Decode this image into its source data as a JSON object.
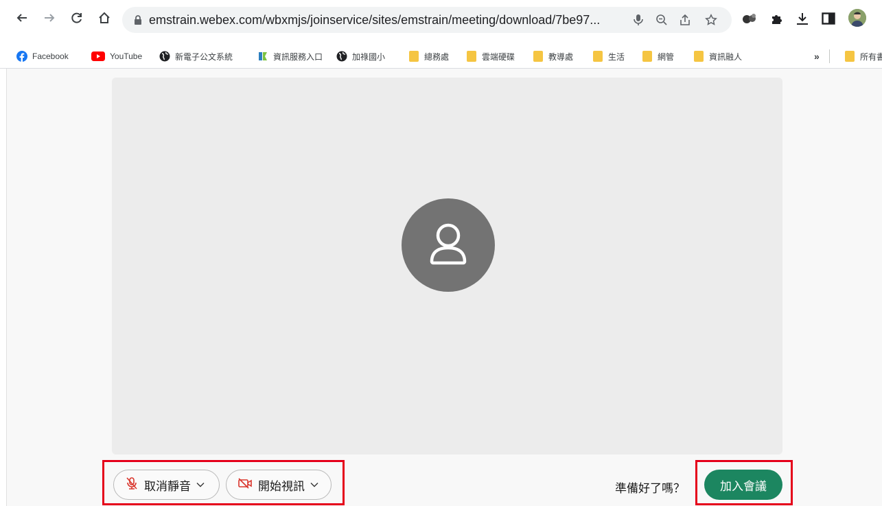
{
  "browser": {
    "url": "emstrain.webex.com/wbxmjs/joinservice/sites/emstrain/meeting/download/7be97...",
    "nav": [
      "back",
      "forward",
      "reload",
      "home"
    ],
    "bookmarks": [
      {
        "label": "Facebook",
        "icon": "facebook-icon"
      },
      {
        "label": "YouTube",
        "icon": "youtube-icon"
      },
      {
        "label": "新電子公文系統",
        "icon": "globe-icon"
      },
      {
        "label": "資訊服務入口",
        "icon": "portal-icon"
      },
      {
        "label": "加祿國小",
        "icon": "globe-icon"
      },
      {
        "label": "總務處",
        "icon": "folder-icon"
      },
      {
        "label": "雲端硬碟",
        "icon": "folder-icon"
      },
      {
        "label": "教導處",
        "icon": "folder-icon"
      },
      {
        "label": "生活",
        "icon": "folder-icon"
      },
      {
        "label": "網管",
        "icon": "folder-icon"
      },
      {
        "label": "資訊融人",
        "icon": "folder-icon"
      }
    ],
    "overflow_label": "»",
    "all_bookmarks_label": "所有書"
  },
  "meeting": {
    "mute_label": "取消靜音",
    "video_label": "開始視訊",
    "ready_text": "準備好了嗎？",
    "join_label": "加入會議",
    "join_color": "#1c8660",
    "highlight_color": "#e5001a"
  }
}
